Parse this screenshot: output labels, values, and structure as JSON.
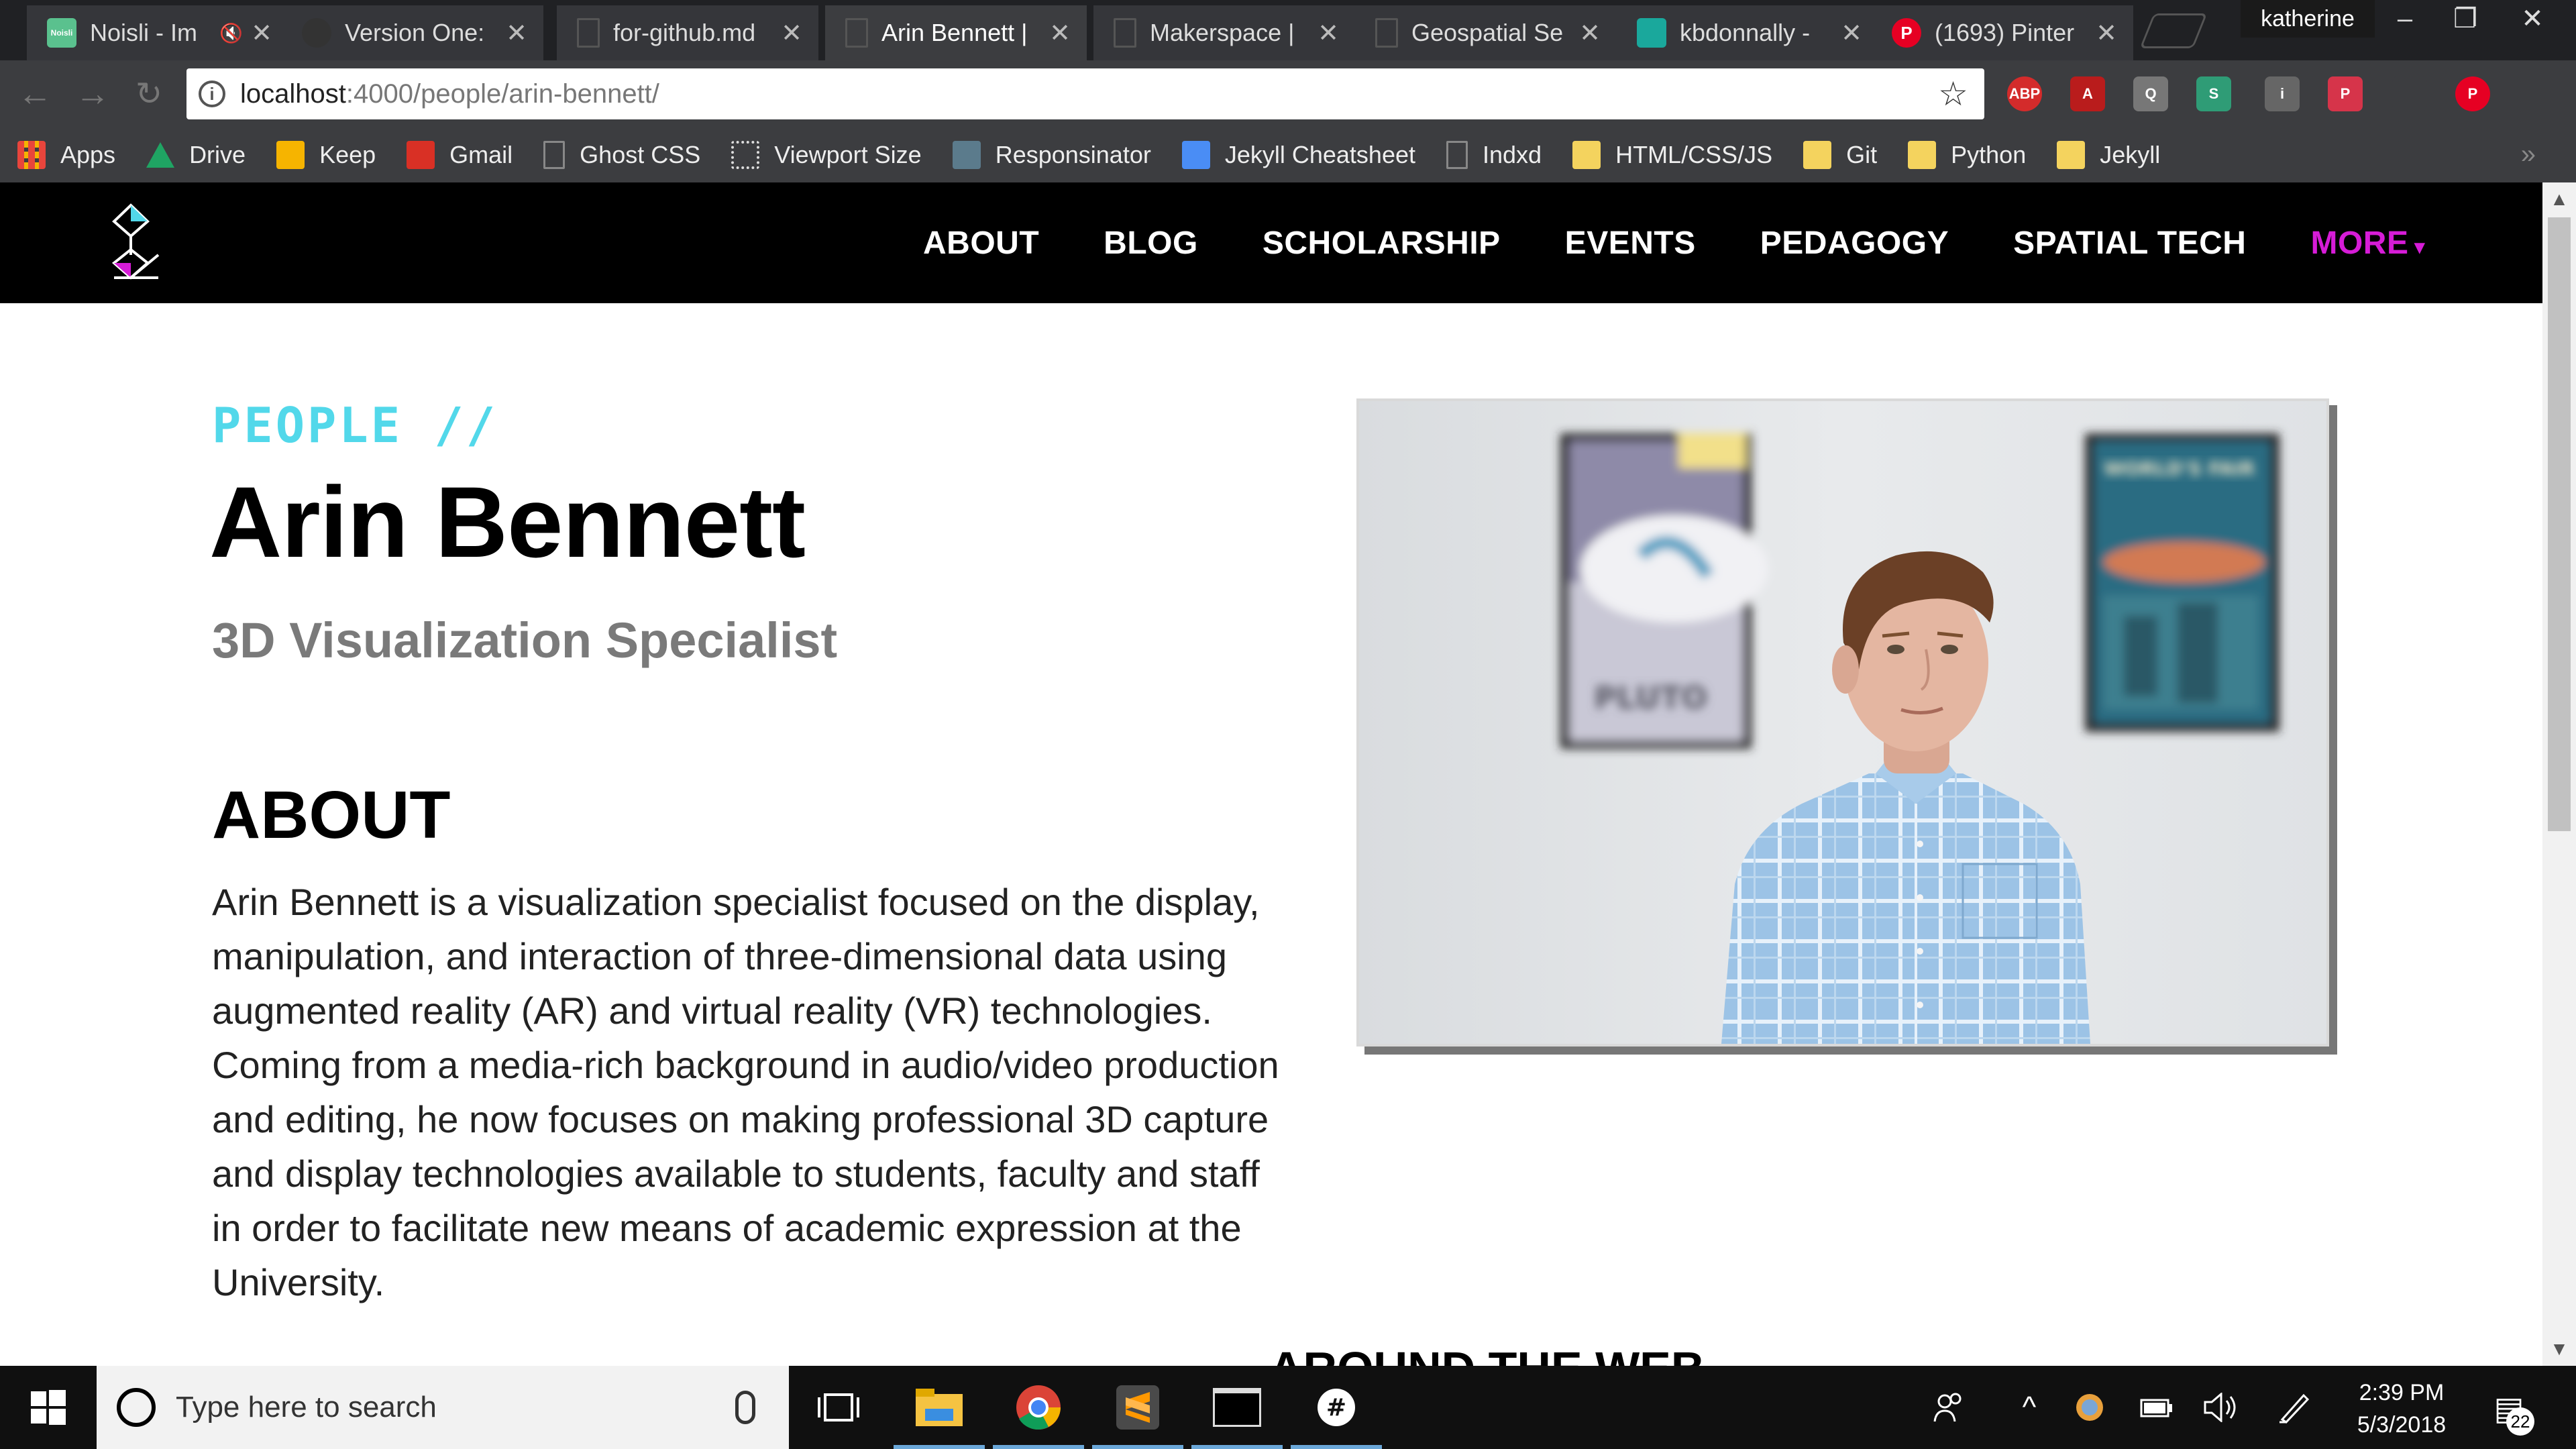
{
  "browser": {
    "tabs": [
      {
        "title": "Noisli - Im",
        "favicon": "noisli-icon",
        "favicon_color": "#5ac18e",
        "fav_text": "Noisli",
        "muted": true
      },
      {
        "title": "Version One:",
        "favicon": "github-icon",
        "favicon_color": "#333333",
        "fav_text": ""
      },
      {
        "title": "for-github.md",
        "favicon": "document-icon",
        "favicon_color": "#555555",
        "fav_text": ""
      },
      {
        "title": "Arin Bennett |",
        "favicon": "document-icon",
        "favicon_color": "#555555",
        "fav_text": "",
        "active": true
      },
      {
        "title": "Makerspace |",
        "favicon": "document-icon",
        "favicon_color": "#555555",
        "fav_text": ""
      },
      {
        "title": "Geospatial Se",
        "favicon": "document-icon",
        "favicon_color": "#555555",
        "fav_text": ""
      },
      {
        "title": "kbdonnally -",
        "favicon": "square-icon",
        "favicon_color": "#1aa89c",
        "fav_text": ""
      },
      {
        "title": "(1693) Pinter",
        "favicon": "pinterest-icon",
        "favicon_color": "#e60023",
        "fav_text": "P"
      }
    ],
    "profile_name": "katherine",
    "address": {
      "host": "localhost",
      "path": ":4000/people/arin-bennett/"
    },
    "extensions": [
      {
        "name": "adblock-plus-icon",
        "label": "ABP",
        "color": "#d42b2b"
      },
      {
        "name": "acrobat-icon",
        "label": "A",
        "color": "#b91c1c"
      },
      {
        "name": "search-page-icon",
        "label": "Q",
        "color": "#777777"
      },
      {
        "name": "stylish-icon",
        "label": "S",
        "color": "#2f9c76"
      },
      {
        "name": "lightbulb-icon",
        "label": "i",
        "color": "#666666"
      },
      {
        "name": "pocket-icon",
        "label": "P",
        "color": "#d6344a"
      },
      {
        "name": "blank-extension-icon",
        "label": "",
        "color": "#3c3d40"
      },
      {
        "name": "pinterest-icon",
        "label": "P",
        "color": "#e60023"
      }
    ],
    "bookmarks": [
      {
        "label": "Apps",
        "icon": "apps-grid-icon",
        "color": "#e8453c"
      },
      {
        "label": "Drive",
        "icon": "google-drive-icon",
        "color": "#1fa463"
      },
      {
        "label": "Keep",
        "icon": "keep-icon",
        "color": "#f6b400"
      },
      {
        "label": "Gmail",
        "icon": "gmail-icon",
        "color": "#d93025"
      },
      {
        "label": "Ghost CSS",
        "icon": "page-icon",
        "color": "#888888"
      },
      {
        "label": "Viewport Size",
        "icon": "viewport-icon",
        "color": "#dddddd"
      },
      {
        "label": "Responsinator",
        "icon": "responsinator-icon",
        "color": "#5b7b8c"
      },
      {
        "label": "Jekyll Cheatsheet",
        "icon": "jekyll-icon",
        "color": "#4a8df5"
      },
      {
        "label": "Indxd",
        "icon": "page-icon",
        "color": "#888888"
      },
      {
        "label": "HTML/CSS/JS",
        "icon": "folder-icon",
        "color": "#f4d35e"
      },
      {
        "label": "Git",
        "icon": "folder-icon",
        "color": "#f4d35e"
      },
      {
        "label": "Python",
        "icon": "folder-icon",
        "color": "#f4d35e"
      },
      {
        "label": "Jekyll",
        "icon": "folder-icon",
        "color": "#f4d35e"
      }
    ]
  },
  "site": {
    "nav": [
      "ABOUT",
      "BLOG",
      "SCHOLARSHIP",
      "EVENTS",
      "PEDAGOGY",
      "SPATIAL TECH"
    ],
    "nav_more": "MORE",
    "accent_cyan": "#52d8ea",
    "accent_magenta": "#d61cd7"
  },
  "profile": {
    "eyebrow": "PEOPLE //",
    "name": "Arin Bennett",
    "role": "3D Visualization Specialist",
    "about_heading": "ABOUT",
    "bio": "Arin Bennett is a visualization specialist focused on the display, manipulation, and interaction of three-dimensional data using augmented reality (AR) and virtual reality (VR) technologies. Coming from a media-rich background in audio/video production and editing, he now focuses on making professional 3D capture and display technologies available to students, faculty and staff in order to facilitate new means of academic expression at the University.",
    "around_heading": "AROUND THE WEB",
    "photo": {
      "poster_left_text": "PLUTO",
      "poster_right_text": "WORLD'S FAIR"
    }
  },
  "taskbar": {
    "search_placeholder": "Type here to search",
    "time": "2:39 PM",
    "date": "5/3/2018",
    "notification_count": "22"
  }
}
